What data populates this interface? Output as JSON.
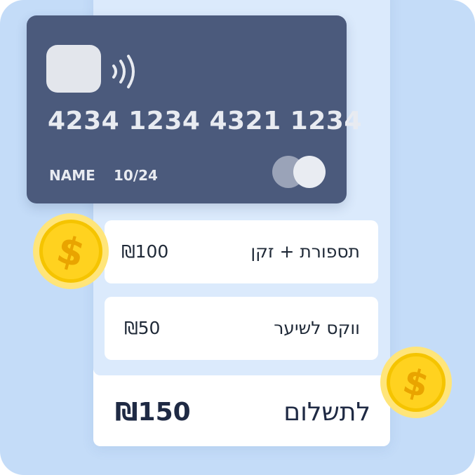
{
  "card": {
    "number": "4234 1234 4321 1234",
    "name": "NAME",
    "expiry": "10/24",
    "icons": [
      "chip-icon",
      "contactless-icon",
      "card-brand-icon"
    ]
  },
  "items": [
    {
      "name": "תספורת + זקן",
      "price": "₪100"
    },
    {
      "name": "ווקס לשיער",
      "price": "₪50"
    }
  ],
  "total": {
    "label": "לתשלום",
    "amount": "₪150"
  },
  "decorations": {
    "coins": [
      "dollar-coin-icon",
      "dollar-coin-icon"
    ]
  },
  "colors": {
    "background": "#c4dcf8",
    "list_area": "#dbeafc",
    "card": "#4b5a7c",
    "coin": "#ffd21f",
    "text": "#1f2a44"
  }
}
